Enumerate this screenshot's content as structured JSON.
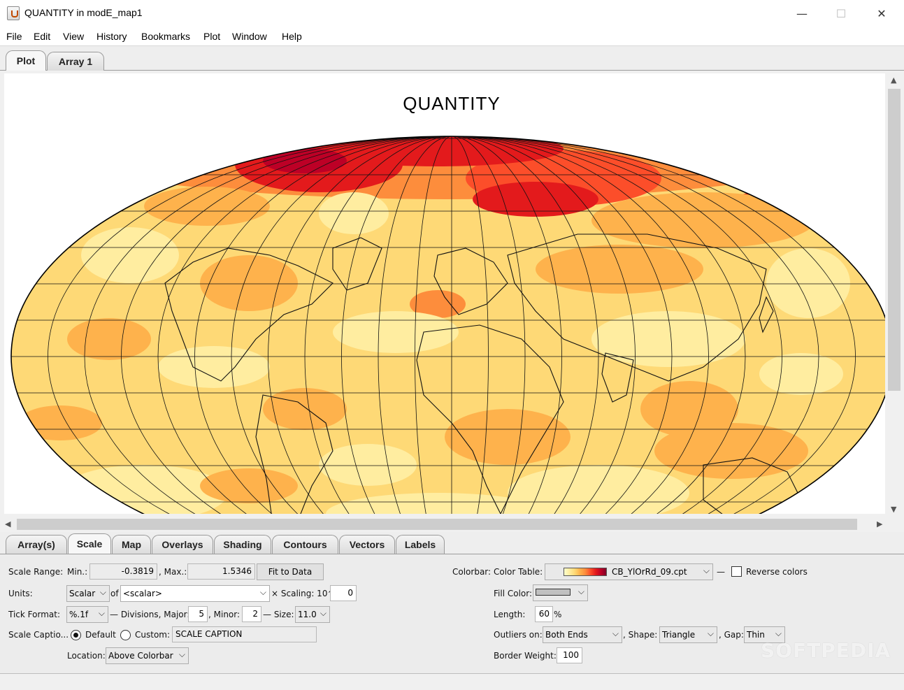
{
  "window": {
    "title": "QUANTITY in modE_map1",
    "minimize_glyph": "—",
    "maximize_glyph": "☐",
    "close_glyph": "✕",
    "icon": "java-app-icon"
  },
  "menu": [
    "File",
    "Edit",
    "View",
    "History",
    "Bookmarks",
    "Plot",
    "Window",
    "Help"
  ],
  "top_tabs": [
    {
      "label": "Plot",
      "active": true
    },
    {
      "label": "Array 1",
      "active": false
    }
  ],
  "plot": {
    "title": "QUANTITY",
    "projection": "Mollweide",
    "color_stops": [
      "#ffffcc",
      "#ffeda0",
      "#fed976",
      "#feb24c",
      "#fd8d3c",
      "#fc4e2a",
      "#e31a1c",
      "#bd0026",
      "#800026"
    ]
  },
  "scrollbars": {
    "up": "▲",
    "down": "▼",
    "left": "◀",
    "right": "▶"
  },
  "bottom_tabs": [
    {
      "label": "Array(s)",
      "active": false
    },
    {
      "label": "Scale",
      "active": true
    },
    {
      "label": "Map",
      "active": false
    },
    {
      "label": "Overlays",
      "active": false
    },
    {
      "label": "Shading",
      "active": false
    },
    {
      "label": "Contours",
      "active": false
    },
    {
      "label": "Vectors",
      "active": false
    },
    {
      "label": "Labels",
      "active": false
    }
  ],
  "scale": {
    "range_label": "Scale Range:",
    "min_label": "Min.:",
    "min_value": "-0.3819",
    "max_label": ", Max.:",
    "max_value": "1.5346",
    "fit_button": "Fit to Data",
    "units_label": "Units:",
    "units_value": "Scalar",
    "of_label": "of",
    "of_value": "<scalar>",
    "scaling_label": "× Scaling: 10^",
    "scaling_value": "0",
    "tick_format_label": "Tick Format:",
    "tick_format_value": "%.1f",
    "divisions_label": "— Divisions, Major:",
    "major_value": "5",
    "minor_label": ", Minor:",
    "minor_value": "2",
    "size_label": "— Size:",
    "size_value": "11.0",
    "caption_label": "Scale Captio...",
    "caption_default": "Default",
    "caption_custom": "Custom:",
    "caption_text": "SCALE CAPTION",
    "location_label": "Location:",
    "location_value": "Above Colorbar"
  },
  "colorbar": {
    "label": "Colorbar:",
    "table_label": "Color Table:",
    "table_value": "CB_YlOrRd_09.cpt",
    "dash": "—",
    "reverse_label": "Reverse colors",
    "reverse_checked": false,
    "fill_label": "Fill Color:",
    "fill_color": "#c0c0c0",
    "length_label": "Length:",
    "length_value": "60",
    "length_unit": "%",
    "outliers_label": "Outliers on:",
    "outliers_value": "Both Ends",
    "shape_label": ", Shape:",
    "shape_value": "Triangle",
    "gap_label": ", Gap:",
    "gap_value": "Thin",
    "border_label": "Border Weight:",
    "border_value": "100"
  },
  "watermark": "SOFTPEDIA"
}
